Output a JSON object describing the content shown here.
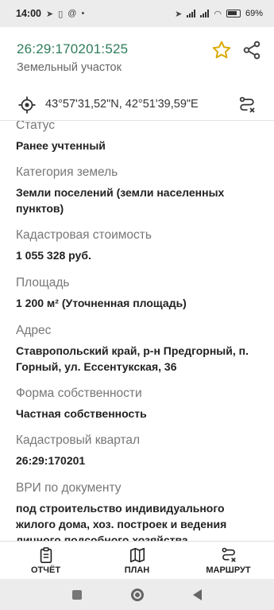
{
  "statusbar": {
    "time": "14:00",
    "battery": "69"
  },
  "header": {
    "cad_number": "26:29:170201:525",
    "subtype": "Земельный участок"
  },
  "coords": {
    "text": "43°57'31,52\"N, 42°51'39,59\"E"
  },
  "fields": [
    {
      "label": "Статус",
      "value": "Ранее учтенный"
    },
    {
      "label": "Категория земель",
      "value": "Земли поселений (земли населенных пунктов)"
    },
    {
      "label": "Кадастровая стоимость",
      "value": "1 055 328 руб."
    },
    {
      "label": "Площадь",
      "value": "1 200 м² (Уточненная площадь)"
    },
    {
      "label": "Адрес",
      "value": "Ставропольский край, р-н Предгорный, п. Горный, ул. Ессентукская, 36"
    },
    {
      "label": "Форма собственности",
      "value": "Частная собственность"
    },
    {
      "label": "Кадастровый квартал",
      "value": "26:29:170201"
    },
    {
      "label": "ВРИ по документу",
      "value": "под строительство индивидуального жилого дома, хоз. построек и ведения личного подсобного хозяйства"
    }
  ],
  "bottomnav": {
    "report": "ОТЧЁТ",
    "plan": "ПЛАН",
    "route": "МАРШРУТ"
  },
  "colors": {
    "accent": "#2e7d5b",
    "star": "#e2b400"
  }
}
